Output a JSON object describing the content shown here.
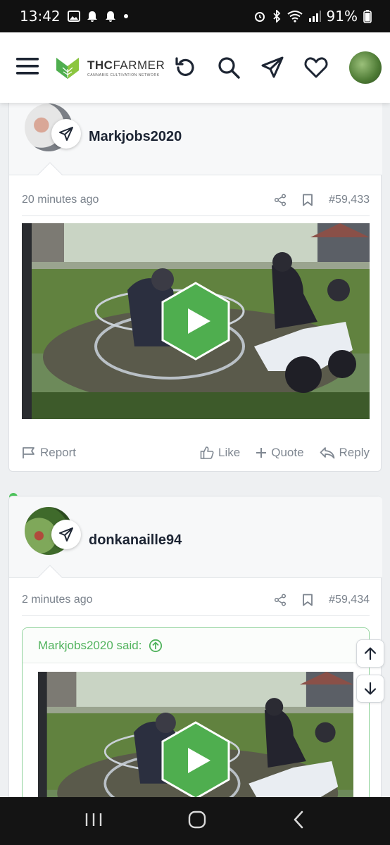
{
  "status": {
    "time": "13:42",
    "battery": "91%"
  },
  "brand": {
    "name_a": "THC",
    "name_b": "FARMER",
    "tagline": "CANNABIS CULTIVATION NETWORK"
  },
  "posts": [
    {
      "username": "Markjobs2020",
      "time_ago": "20 minutes ago",
      "number": "#59,433",
      "actions": {
        "report": "Report",
        "like": "Like",
        "quote": "Quote",
        "reply": "Reply"
      }
    },
    {
      "username": "donkanaille94",
      "time_ago": "2 minutes ago",
      "number": "#59,434",
      "quote_author": "Markjobs2020 said:"
    }
  ],
  "colors": {
    "accent_green": "#4fae4f",
    "online": "#4cc25a",
    "quote_border": "#8fd29a"
  },
  "icons": [
    "menu-icon",
    "brand-logo",
    "refresh-icon",
    "search-icon",
    "send-icon",
    "heart-icon",
    "share-icon",
    "bookmark-icon",
    "flag-icon",
    "thumbs-up-icon",
    "plus-icon",
    "reply-icon",
    "arrow-up-circle-icon",
    "play-icon",
    "arrow-up-icon",
    "arrow-down-icon",
    "recents-icon",
    "home-icon",
    "back-icon"
  ]
}
